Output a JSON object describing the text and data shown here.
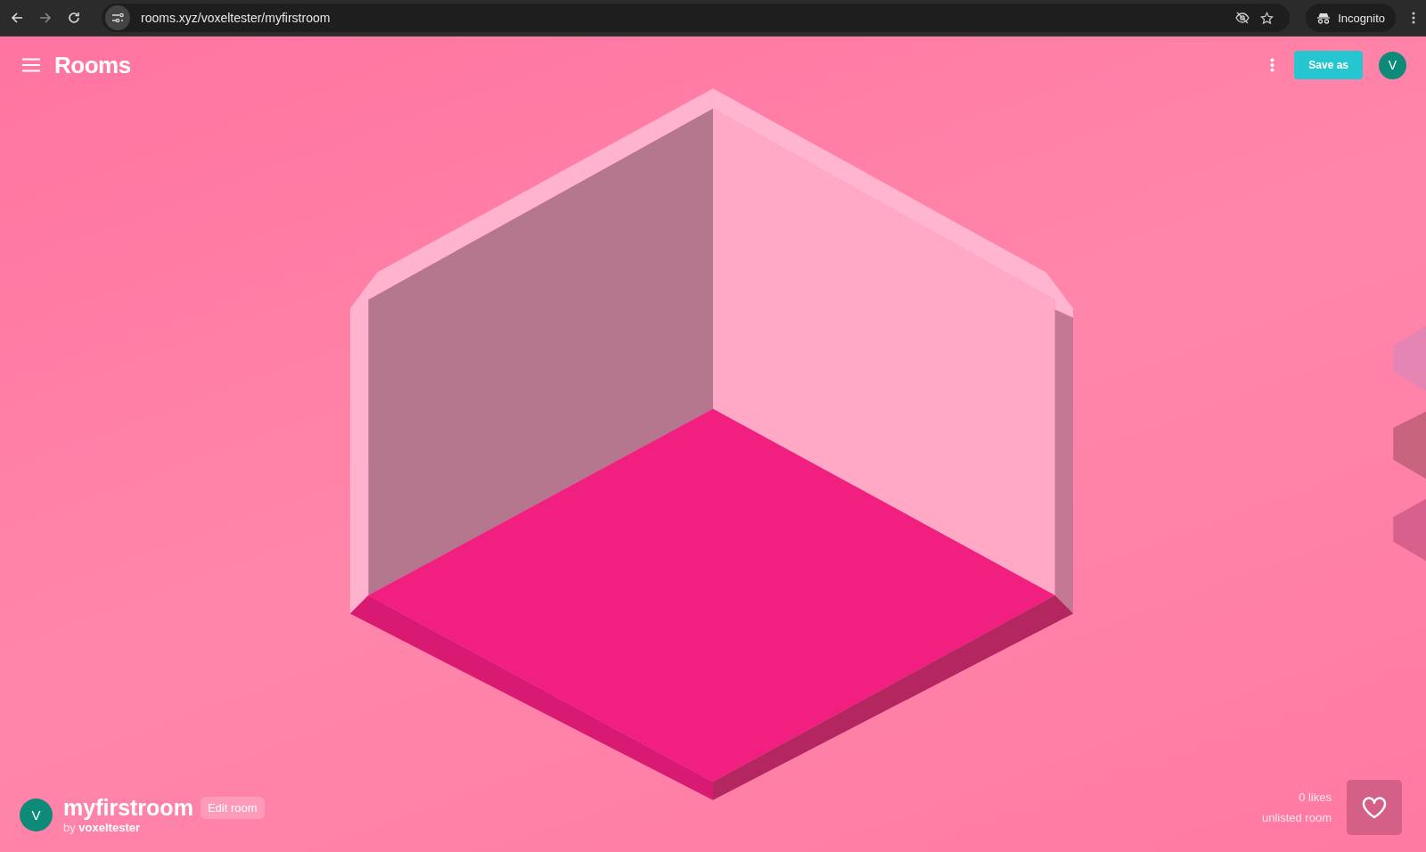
{
  "browser": {
    "url": "rooms.xyz/voxeltester/myfirstroom",
    "profile": "Incognito"
  },
  "header": {
    "title": "Rooms",
    "save_button": "Save as",
    "avatar": "V"
  },
  "room": {
    "avatar": "V",
    "name": "myfirstroom",
    "edit_button": "Edit room",
    "byline": "by **voxeltester**",
    "likes": "0 likes",
    "visibility": "unlisted room"
  }
}
